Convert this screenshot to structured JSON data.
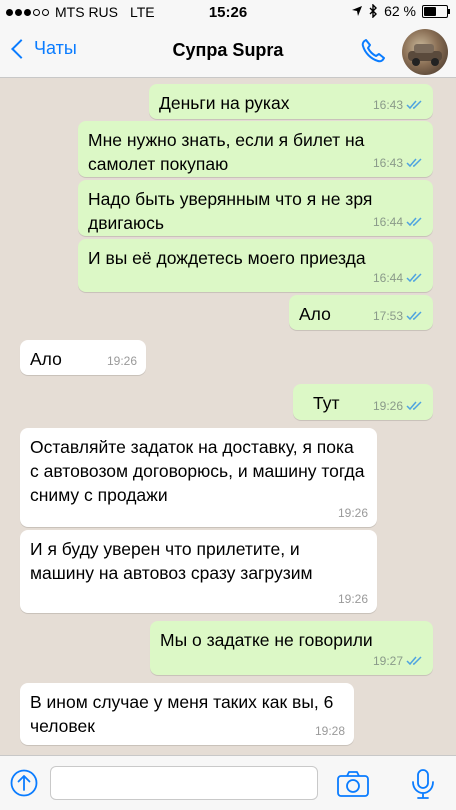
{
  "status_bar": {
    "carrier": "MTS RUS",
    "network": "LTE",
    "time": "15:26",
    "battery": "62 %",
    "battery_level": 0.62
  },
  "header": {
    "back_label": "Чаты",
    "title": "Супра Supra"
  },
  "messages": [
    {
      "direction": "out",
      "text": "Деньги на руках",
      "time": "16:43",
      "read": true
    },
    {
      "direction": "out",
      "text": "Мне нужно знать, если я билет на самолет покупаю",
      "time": "16:43",
      "read": true
    },
    {
      "direction": "out",
      "text": "Надо быть уверянным что я не зря двигаюсь",
      "time": "16:44",
      "read": true
    },
    {
      "direction": "out",
      "text": "И вы её дождетесь моего приезда",
      "time": "16:44",
      "read": true
    },
    {
      "direction": "out",
      "text": "Ало",
      "time": "17:53",
      "read": true
    },
    {
      "direction": "in",
      "text": "Ало",
      "time": "19:26"
    },
    {
      "direction": "out",
      "text": "Тут",
      "time": "19:26",
      "read": true
    },
    {
      "direction": "in",
      "text": "Оставляйте задаток на доставку, я пока с автовозом договорюсь, и машину тогда сниму с продажи",
      "time": "19:26"
    },
    {
      "direction": "in",
      "text": "И я буду уверен что прилетите, и машину на автовоз сразу загрузим",
      "time": "19:26"
    },
    {
      "direction": "out",
      "text": "Мы о задатке не говорили",
      "time": "19:27",
      "read": true
    },
    {
      "direction": "in",
      "text": "В ином случае у меня таких как вы, 6 человек",
      "time": "19:28"
    }
  ],
  "colors": {
    "accent": "#0a7cff",
    "outgoing_bubble": "#dcf8c6",
    "incoming_bubble": "#ffffff",
    "chat_background": "#e5ddd5",
    "read_ticks": "#4fa3e0"
  },
  "icons": {
    "back": "chevron-left-icon",
    "call": "phone-icon",
    "upload": "arrow-up-circle-icon",
    "camera": "camera-icon",
    "mic": "microphone-icon"
  }
}
